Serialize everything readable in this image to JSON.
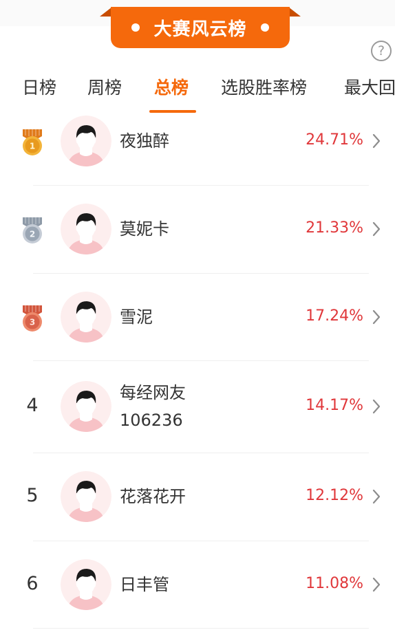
{
  "header": {
    "title": "大赛风云榜",
    "help_icon": "help-circle-icon",
    "accent_color": "#f5690c"
  },
  "tabs": [
    {
      "label": "日榜",
      "active": false
    },
    {
      "label": "周榜",
      "active": false
    },
    {
      "label": "总榜",
      "active": true
    },
    {
      "label": "选股胜率榜",
      "active": false
    },
    {
      "label": "最大回",
      "active": false
    }
  ],
  "ranking": [
    {
      "rank": "1",
      "rank_icon": "gold-medal-icon",
      "name_lines": [
        "夜独醉"
      ],
      "rate": "24.71%"
    },
    {
      "rank": "2",
      "rank_icon": "silver-medal-icon",
      "name_lines": [
        "莫妮卡"
      ],
      "rate": "21.33%"
    },
    {
      "rank": "3",
      "rank_icon": "bronze-medal-icon",
      "name_lines": [
        "雪泥"
      ],
      "rate": "17.24%"
    },
    {
      "rank": "4",
      "rank_icon": "",
      "name_lines": [
        "每经网友",
        "106236"
      ],
      "rate": "14.17%"
    },
    {
      "rank": "5",
      "rank_icon": "",
      "name_lines": [
        "花落花开"
      ],
      "rate": "12.12%"
    },
    {
      "rank": "6",
      "rank_icon": "",
      "name_lines": [
        "日丰管"
      ],
      "rate": "11.08%"
    }
  ],
  "colors": {
    "rate": "#e0373a",
    "gold": "#e8a020",
    "silver": "#a9b3bf",
    "bronze": "#d9624a"
  }
}
